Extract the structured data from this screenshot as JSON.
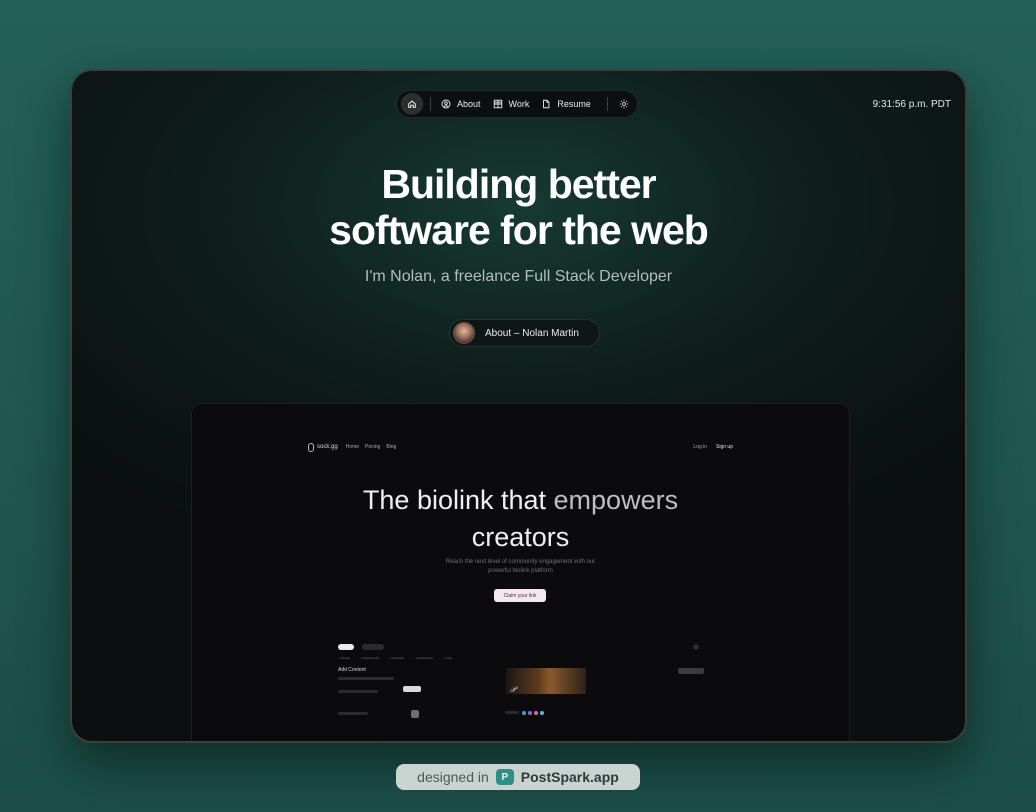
{
  "nav": {
    "items": [
      {
        "label": "About",
        "icon": "user-circle-icon"
      },
      {
        "label": "Work",
        "icon": "grid-icon"
      },
      {
        "label": "Resume",
        "icon": "document-icon"
      }
    ]
  },
  "clock": "9:31:56 p.m. PDT",
  "hero": {
    "title_line1": "Building better",
    "title_line2": "software for the web",
    "subtitle": "I'm Nolan, a freelance Full Stack Developer",
    "about_pill": "About – Nolan Martin"
  },
  "preview": {
    "brand": "sock.gg",
    "links": [
      "Home",
      "Pricing",
      "Blog"
    ],
    "login": "Log in",
    "signup": "Sign up",
    "title_part1": "The biolink that ",
    "title_part2": "empowers",
    "title_line2": "creators",
    "subtitle_line1": "Reach the next level of community engagement with our",
    "subtitle_line2": "powerful biolink platform",
    "cta": "Claim your link",
    "add_content": "Add Content"
  },
  "footer": {
    "prefix": "designed in",
    "brand": "PostSpark.app"
  },
  "colors": {
    "background": "#236058",
    "window": "#0b0f0f",
    "accent": "#2f8f86"
  }
}
